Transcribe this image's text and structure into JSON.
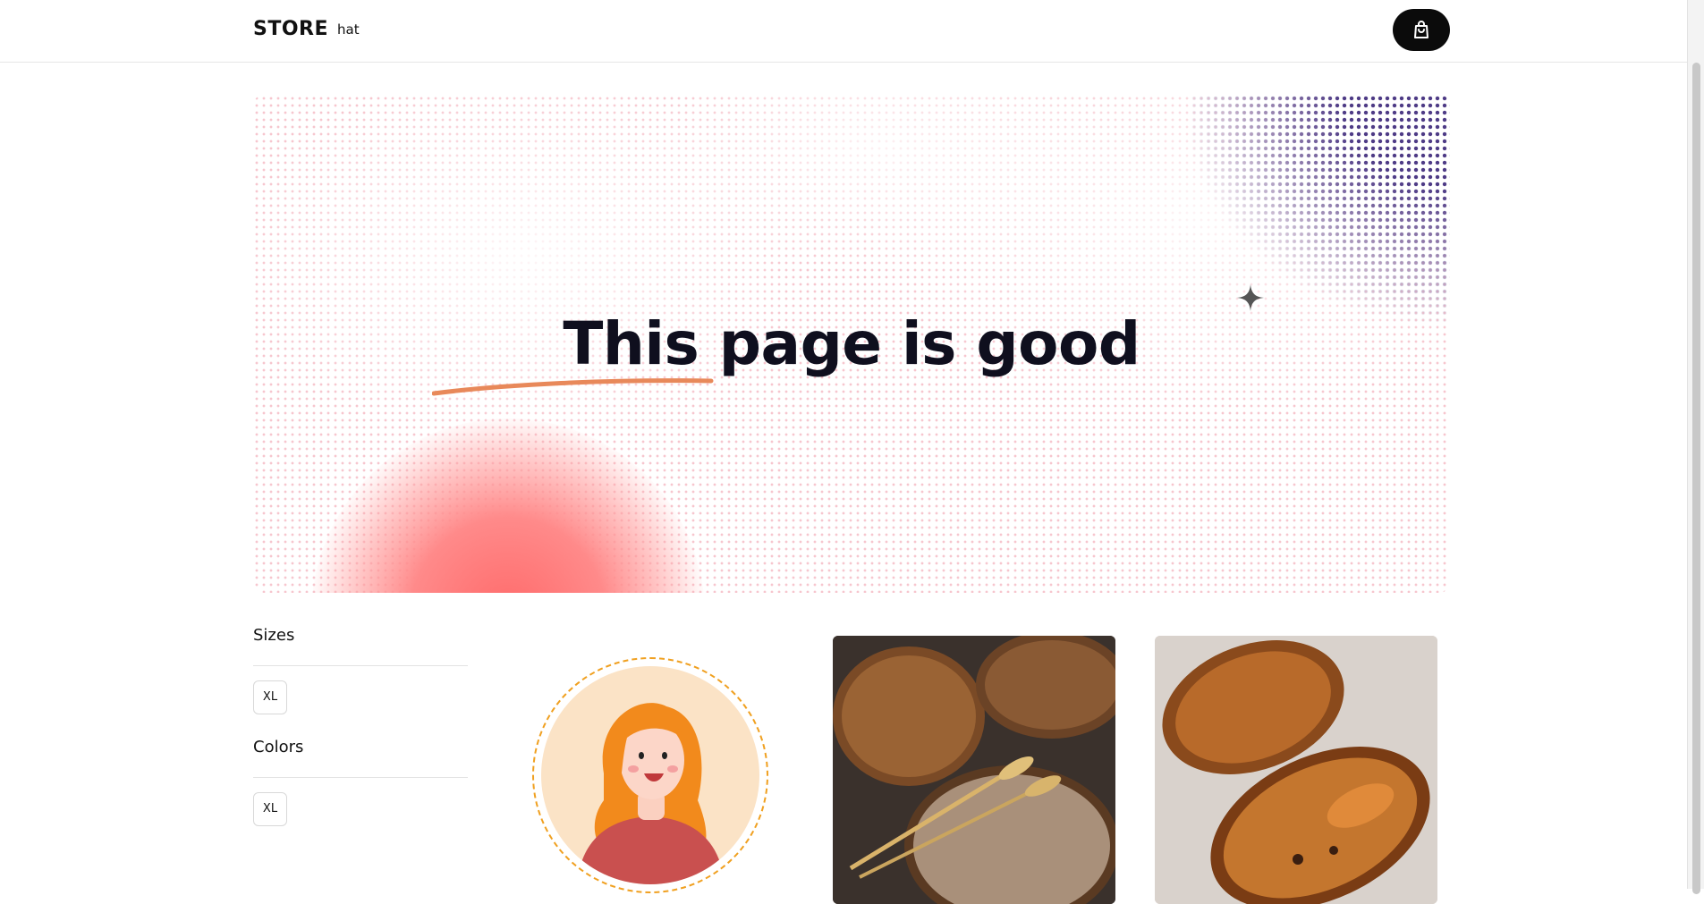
{
  "header": {
    "logo": "STORE",
    "nav_link": "hat",
    "cart_icon": "shopping-bag-icon"
  },
  "hero": {
    "title": "This page is good",
    "sparkle_icon": "sparkle-icon"
  },
  "filters": {
    "sizes_heading": "Sizes",
    "sizes": [
      "XL"
    ],
    "colors_heading": "Colors",
    "colors": [
      "XL"
    ]
  },
  "products": [
    {
      "image": "girl-avatar"
    },
    {
      "image": "bread-loaves"
    },
    {
      "image": "croissants"
    }
  ],
  "colors": {
    "accent_dark": "#0b0b0b",
    "hero_dots_pink": "#f096a5",
    "hero_dots_purple": "#4e3b86",
    "hero_sun": "#ff6b6b",
    "stroke_orange": "#e8895a",
    "avatar_border": "#f0a020"
  }
}
